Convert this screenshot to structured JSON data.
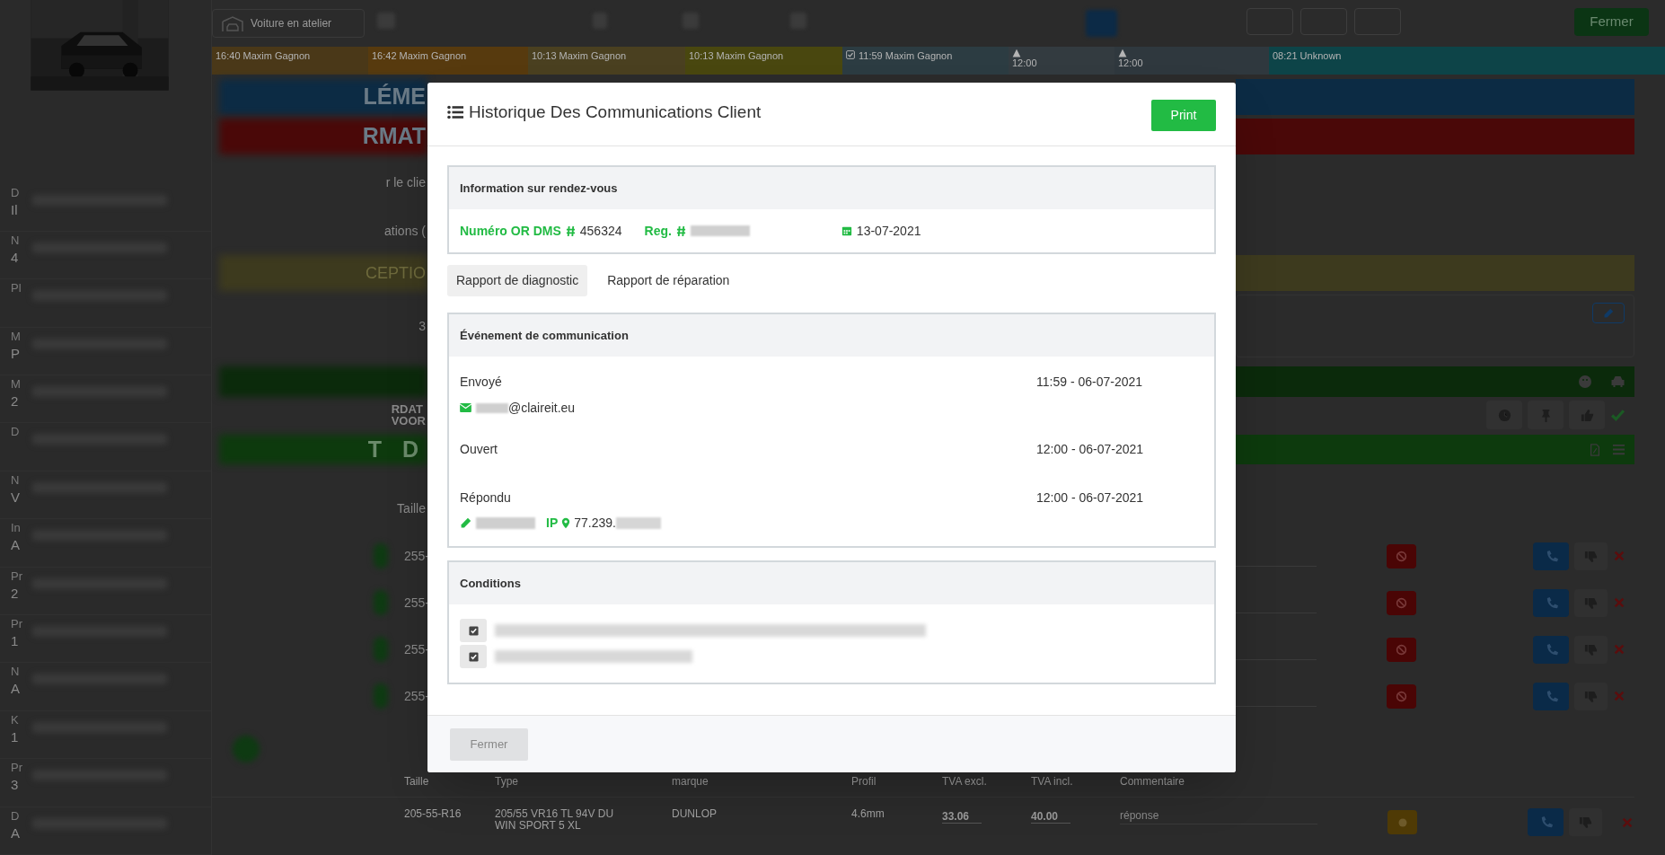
{
  "sidebar": {
    "fields": [
      {
        "label": "D",
        "value": "Il"
      },
      {
        "label": "N",
        "value": "4"
      },
      {
        "label": "Pl"
      },
      {
        "label": "M",
        "value": "P"
      },
      {
        "label": "M",
        "value": "2"
      },
      {
        "label": "D"
      },
      {
        "label": "N",
        "value": "V"
      },
      {
        "label": "In",
        "value": "A"
      },
      {
        "label": "Pr",
        "value": "2"
      },
      {
        "label": "Pr",
        "value": "1"
      },
      {
        "label": "N",
        "value": "A"
      },
      {
        "label": "K",
        "value": "1"
      },
      {
        "label": "Pr",
        "value": "3"
      },
      {
        "label": "D",
        "value": "A"
      }
    ]
  },
  "topbar": {
    "workshop_button": "Voiture en atelier",
    "close_button": "Fermer"
  },
  "timeline": [
    {
      "kind": "appointment",
      "time": "16:40",
      "name": "Maxim Gagnon",
      "color": "#4a3818"
    },
    {
      "kind": "appointment",
      "time": "16:42",
      "name": "Maxim Gagnon",
      "color": "#573a0e"
    },
    {
      "kind": "appointment",
      "time": "10:13",
      "name": "Maxim Gagnon",
      "color": "#4a4020"
    },
    {
      "kind": "appointment",
      "time": "10:13",
      "name": "Maxim Gagnon",
      "color": "#49470f"
    },
    {
      "kind": "checked",
      "time": "11:59",
      "name": "Maxim Gagnon",
      "color": "#2c3c42"
    },
    {
      "kind": "warning",
      "time": "12:00",
      "color": "#333b40"
    },
    {
      "kind": "warning",
      "time": "12:00",
      "color": "#2f383e"
    },
    {
      "kind": "appointment",
      "time": "08:21",
      "name": "Unknown",
      "color": "#0d4448"
    }
  ],
  "page_rows": [
    {
      "kind": "banner",
      "text": "LÉME",
      "color": "#0c2b44"
    },
    {
      "kind": "banner",
      "text": "RMAT",
      "color": "#4a0808"
    },
    {
      "kind": "line",
      "text": "r le clie"
    },
    {
      "kind": "line",
      "text": "ations ("
    },
    {
      "kind": "banner",
      "text": "CEPTIO",
      "color": "#3d3a1e"
    },
    {
      "kind": "card",
      "text": "3"
    },
    {
      "kind": "vehicle_banner",
      "color": "#0b2a0b"
    },
    {
      "kind": "tools",
      "lines": [
        "RDAT",
        "VOOR"
      ]
    },
    {
      "kind": "document_banner",
      "text": "T D",
      "color": "#0d3a0d"
    },
    {
      "kind": "line",
      "text": "Taille"
    },
    {
      "kind": "tire_row",
      "text": "255-"
    },
    {
      "kind": "tire_row",
      "text": "255-"
    },
    {
      "kind": "tire_row",
      "text": "255-"
    },
    {
      "kind": "tire_row",
      "text": "255-"
    }
  ],
  "tire_table": {
    "columns": [
      "Taille",
      "Type",
      "marque",
      "Profil",
      "TVA excl.",
      "TVA incl.",
      "Commentaire"
    ],
    "rows": [
      {
        "size": "205-55-R16",
        "type": "205/55 VR16 TL 94V DU WIN SPORT 5 XL",
        "brand": "DUNLOP",
        "profile": "4.6mm",
        "price_excl": "33.06",
        "price_incl": "40.00",
        "comment_placeholder": "réponse"
      }
    ]
  },
  "modal": {
    "title": "Historique Des Communications Client",
    "print_button": "Print",
    "appointment": {
      "heading": "Information sur rendez-vous",
      "order_label": "Numéro OR DMS",
      "order_number": "456324",
      "reg_label": "Reg.",
      "date": "13-07-2021"
    },
    "tabs": [
      {
        "label": "Rapport de diagnostic",
        "selected": true
      },
      {
        "label": "Rapport de réparation",
        "selected": false
      }
    ],
    "events": {
      "heading": "Événement de communication",
      "items": [
        {
          "kind": "sent",
          "label": "Envoyé",
          "time": "11:59 - 06-07-2021",
          "email": "@claireit.eu"
        },
        {
          "kind": "opened",
          "label": "Ouvert",
          "time": "12:00 - 06-07-2021"
        },
        {
          "kind": "answered",
          "label": "Répondu",
          "time": "12:00 - 06-07-2021",
          "ip_label": "IP",
          "ip": "77.239."
        }
      ]
    },
    "conditions": {
      "heading": "Conditions",
      "items": [
        {
          "checked": true
        },
        {
          "checked": true
        }
      ]
    },
    "close_button": "Fermer"
  }
}
